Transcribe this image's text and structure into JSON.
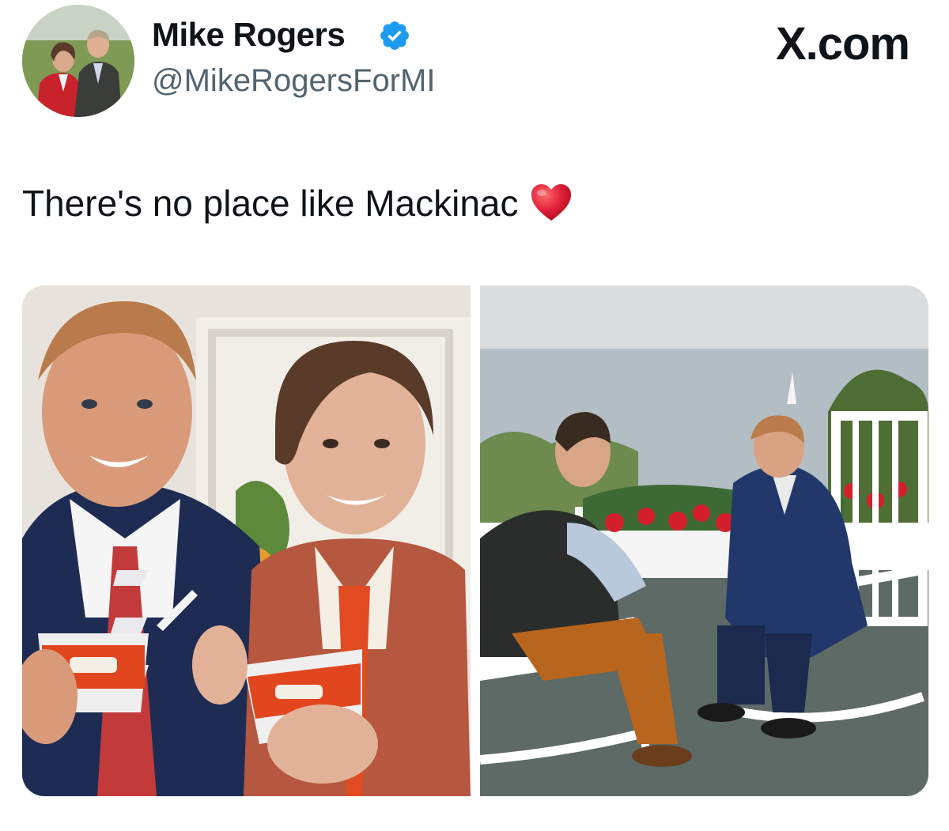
{
  "tweet": {
    "author_name": "Mike Rogers",
    "handle": "@MikeRogersForMI",
    "verified": true,
    "text": "There's no place like Mackinac",
    "emoji": "red-heart",
    "site": "X.com"
  },
  "colors": {
    "verified_badge": "#1d9bf0",
    "heart": "#e0203a",
    "handle": "#536471",
    "text": "#0f1419"
  },
  "media": {
    "photos": [
      {
        "name": "ice-cream-photo"
      },
      {
        "name": "porch-interview-photo"
      }
    ]
  }
}
